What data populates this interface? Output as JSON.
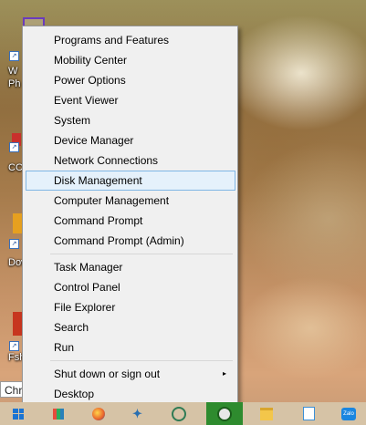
{
  "desktop": {
    "search_value": "Chr",
    "icons": [
      {
        "label": "W",
        "name": "desktop-shortcut-1"
      },
      {
        "label": "Ph",
        "name": "desktop-shortcut-1-line2"
      },
      {
        "label": "CC",
        "name": "desktop-shortcut-2"
      },
      {
        "label": "Dov",
        "name": "desktop-shortcut-3"
      },
      {
        "label": "Fsh",
        "name": "desktop-shortcut-4"
      }
    ]
  },
  "menu": {
    "items": [
      {
        "label": "Programs and Features"
      },
      {
        "label": "Mobility Center"
      },
      {
        "label": "Power Options"
      },
      {
        "label": "Event Viewer"
      },
      {
        "label": "System"
      },
      {
        "label": "Device Manager"
      },
      {
        "label": "Network Connections"
      },
      {
        "label": "Disk Management"
      },
      {
        "label": "Computer Management"
      },
      {
        "label": "Command Prompt"
      },
      {
        "label": "Command Prompt (Admin)"
      },
      {
        "label": "Task Manager"
      },
      {
        "label": "Control Panel"
      },
      {
        "label": "File Explorer"
      },
      {
        "label": "Search"
      },
      {
        "label": "Run"
      },
      {
        "label": "Shut down or sign out"
      },
      {
        "label": "Desktop"
      }
    ],
    "selected_index": 7,
    "submenu_arrow": "▸"
  },
  "taskbar": {
    "icons": [
      "windows-logo-icon",
      "apps-grid-icon",
      "firefox-icon",
      "fontforge-icon",
      "headset-icon",
      "greenshot-icon",
      "folder-icon",
      "notepad-icon",
      "zalo-icon"
    ],
    "zalo_label": "Zalo"
  }
}
